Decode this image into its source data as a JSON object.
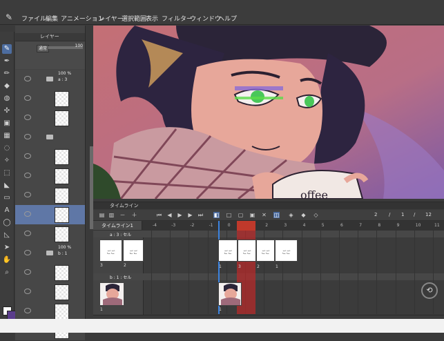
{
  "menu": {
    "items": [
      "ファイル",
      "編集",
      "アニメーション",
      "レイヤー",
      "選択範囲",
      "表示",
      "フィルター",
      "ウィンドウ",
      "ヘルプ"
    ]
  },
  "layer_panel": {
    "title": "レイヤー",
    "blend_mode": "通常",
    "opacity": "100",
    "rows": [
      {
        "kind": "folder",
        "pct": "100 %",
        "name": "a : 3"
      },
      {
        "kind": "cel"
      },
      {
        "kind": "cel"
      },
      {
        "kind": "folder",
        "pct": "",
        "name": ""
      },
      {
        "kind": "cel"
      },
      {
        "kind": "cel"
      },
      {
        "kind": "cel"
      },
      {
        "kind": "cel"
      },
      {
        "kind": "cel"
      },
      {
        "kind": "folder",
        "pct": "100 %",
        "name": "b : 1"
      },
      {
        "kind": "cel"
      },
      {
        "kind": "cel"
      },
      {
        "kind": "cel"
      },
      {
        "kind": "cel"
      }
    ]
  },
  "canvas": {
    "mug_text": "offee"
  },
  "timeline": {
    "title": "タイムライン",
    "timeline_name": "タイムライン1",
    "frame_readout": [
      "2",
      "/",
      "1",
      "/",
      "12"
    ],
    "ruler": [
      "-4",
      "-3",
      "-2",
      "-1",
      "0",
      "1",
      "2",
      "3",
      "4",
      "5",
      "6",
      "7",
      "8",
      "9",
      "10",
      "11",
      "12"
    ],
    "tracks": [
      {
        "name": "a : 3 : セル",
        "left_cells": [
          {
            "label": "ごご",
            "num": "3"
          },
          {
            "label": "ごご",
            "num": "2"
          }
        ],
        "cells": [
          {
            "label": "ごご",
            "num": "1"
          },
          {
            "label": "ごご",
            "num": "3"
          },
          {
            "label": "ごご",
            "num": "2"
          },
          {
            "label": "ごご",
            "num": "1"
          }
        ]
      },
      {
        "name": "b : 1 : セル",
        "left_num": "1",
        "cell_num": "1"
      }
    ]
  },
  "colors": {
    "accent": "#4d6da0",
    "playhead": "#c0392b",
    "sky_top": "#c46f75",
    "sky_bottom": "#7b5aa6"
  },
  "icons": [
    "pen-icon",
    "brush-icon",
    "eraser-icon",
    "fill-icon",
    "text-icon",
    "eyedropper-icon",
    "hand-icon",
    "zoom-icon",
    "play-icon",
    "stop-icon",
    "pencil-icon"
  ]
}
